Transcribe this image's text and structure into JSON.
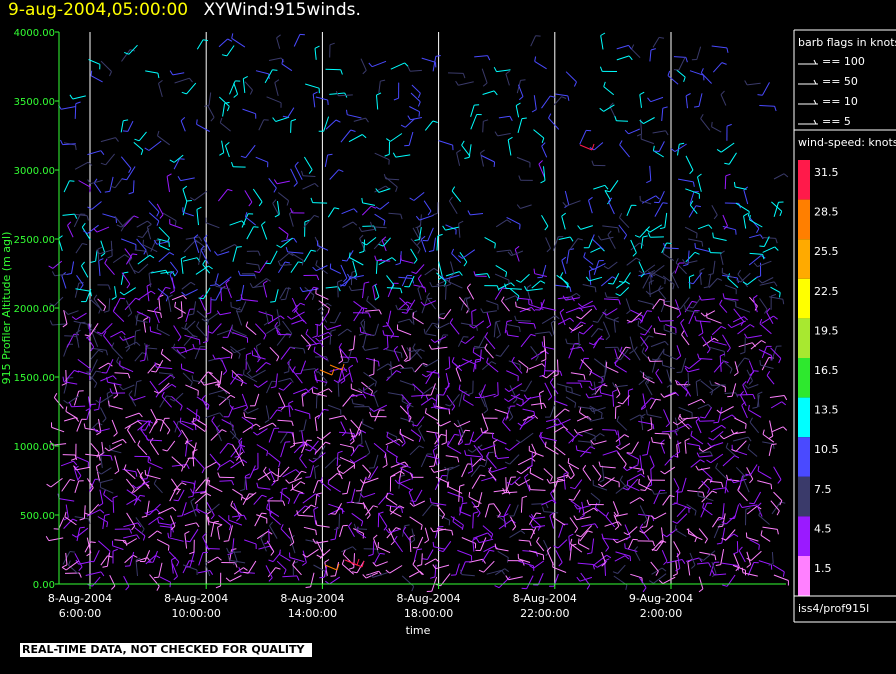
{
  "header": {
    "datetime": "9-aug-2004,05:00:00",
    "product": "XYWind:915winds."
  },
  "chart_data": {
    "type": "scatter",
    "subtype": "wind-barb time-height plot",
    "ylabel": "915 Profiler Altitude (m agl)",
    "xlabel": "time",
    "yticks": [
      "4000.00",
      "3500.00",
      "3000.00",
      "2500.00",
      "2000.00",
      "1500.00",
      "1000.00",
      "500.00",
      "0.00"
    ],
    "ylim": [
      0,
      4000
    ],
    "xticks": [
      {
        "date": "8-Aug-2004",
        "time": "6:00:00"
      },
      {
        "date": "8-Aug-2004",
        "time": "10:00:00"
      },
      {
        "date": "8-Aug-2004",
        "time": "14:00:00"
      },
      {
        "date": "8-Aug-2004",
        "time": "18:00:00"
      },
      {
        "date": "8-Aug-2004",
        "time": "22:00:00"
      },
      {
        "date": "9-Aug-2004",
        "time": "2:00:00"
      }
    ],
    "xlim_hours_since_start": [
      0,
      24
    ],
    "vertical_gridlines": true,
    "barb_legend": {
      "title": "barb flags in knots",
      "entries": [
        "== 100",
        "== 50",
        "== 10",
        "== 5"
      ]
    },
    "colorbar": {
      "title": "wind-speed: knots",
      "values": [
        "31.5",
        "28.5",
        "25.5",
        "22.5",
        "19.5",
        "16.5",
        "13.5",
        "10.5",
        "7.5",
        "4.5",
        "1.5"
      ],
      "colors": [
        "#ff1a4a",
        "#ff7f00",
        "#ffaa00",
        "#ffff00",
        "#a8e830",
        "#2ee82e",
        "#00ffff",
        "#4a4aff",
        "#3a3a6a",
        "#9a1aff",
        "#ff80ff"
      ]
    },
    "source": "iss4/prof915l",
    "notice": "REAL-TIME DATA, NOT CHECKED FOR QUALITY"
  },
  "colors": {
    "axis": "#33ff33",
    "axis_text": "#33ff33",
    "grid": "#ffffff",
    "title_date": "#ffff00"
  }
}
